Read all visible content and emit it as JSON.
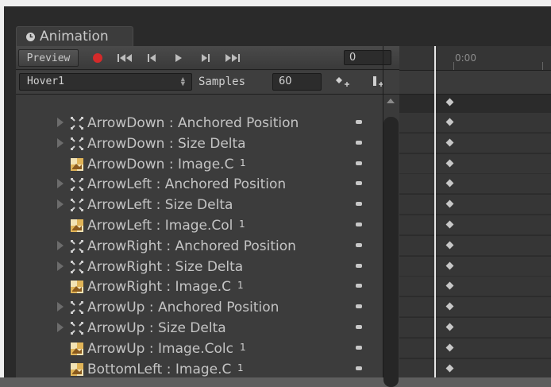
{
  "window": {
    "tab_title": "Animation"
  },
  "toolbar": {
    "preview_label": "Preview",
    "frame_value": "0",
    "record_color": "#d42a2a"
  },
  "clip": {
    "name": "Hover1",
    "samples_label": "Samples",
    "samples_value": "60"
  },
  "timeline": {
    "labels": [
      "0:00"
    ]
  },
  "properties": [
    {
      "label": "ArrowDown : Anchored Position",
      "icon": "rect-transform-icon",
      "foldable": true,
      "value": ""
    },
    {
      "label": "ArrowDown : Size Delta",
      "icon": "rect-transform-icon",
      "foldable": true,
      "value": ""
    },
    {
      "label": "ArrowDown : Image.C",
      "icon": "image-component-icon",
      "foldable": false,
      "value": "1"
    },
    {
      "label": "ArrowLeft : Anchored Position",
      "icon": "rect-transform-icon",
      "foldable": true,
      "value": ""
    },
    {
      "label": "ArrowLeft : Size Delta",
      "icon": "rect-transform-icon",
      "foldable": true,
      "value": ""
    },
    {
      "label": "ArrowLeft : Image.Col",
      "icon": "image-component-icon",
      "foldable": false,
      "value": "1"
    },
    {
      "label": "ArrowRight : Anchored Position",
      "icon": "rect-transform-icon",
      "foldable": true,
      "value": ""
    },
    {
      "label": "ArrowRight : Size Delta",
      "icon": "rect-transform-icon",
      "foldable": true,
      "value": ""
    },
    {
      "label": "ArrowRight : Image.C",
      "icon": "image-component-icon",
      "foldable": false,
      "value": "1"
    },
    {
      "label": "ArrowUp : Anchored Position",
      "icon": "rect-transform-icon",
      "foldable": true,
      "value": ""
    },
    {
      "label": "ArrowUp : Size Delta",
      "icon": "rect-transform-icon",
      "foldable": true,
      "value": ""
    },
    {
      "label": "ArrowUp : Image.Colc",
      "icon": "image-component-icon",
      "foldable": false,
      "value": "1"
    },
    {
      "label": "BottomLeft : Image.C",
      "icon": "image-component-icon",
      "foldable": false,
      "value": "1"
    }
  ]
}
